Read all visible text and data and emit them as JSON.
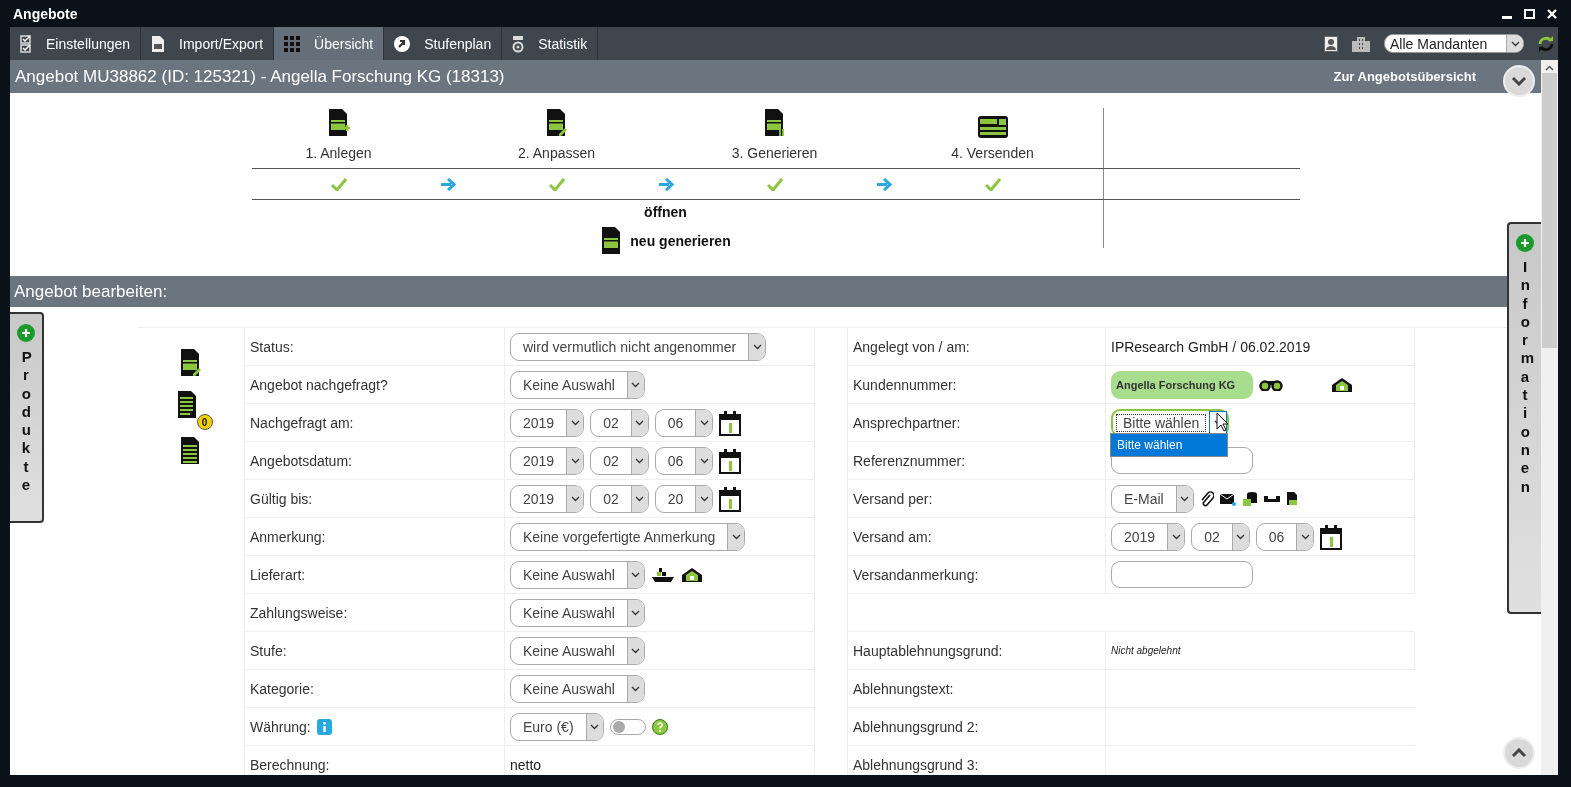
{
  "window": {
    "title": "Angebote"
  },
  "tabs": [
    {
      "label": "Einstellungen",
      "selected": false
    },
    {
      "label": "Import/Export",
      "selected": false
    },
    {
      "label": "Übersicht",
      "selected": true
    },
    {
      "label": "Stufenplan",
      "selected": false
    },
    {
      "label": "Statistik",
      "selected": false
    }
  ],
  "client_select": {
    "value": "Alle Mandanten"
  },
  "header": {
    "title": "Angebot MU38862 (ID: 125321) - Angella Forschung KG (18313)",
    "link": "Zur Angebotsübersicht"
  },
  "steps": [
    {
      "label": "1. Anlegen",
      "done": true
    },
    {
      "label": "2. Anpassen",
      "done": true
    },
    {
      "label": "3. Generieren",
      "done": true
    },
    {
      "label": "4. Versenden",
      "done": true
    }
  ],
  "step_actions": [
    {
      "label": "öffnen",
      "kind": "plain"
    },
    {
      "label": "neu generieren",
      "kind": "icon"
    }
  ],
  "section_title": "Angebot bearbeiten:",
  "side_tabs": {
    "left": "Produkte",
    "right": "Informationen"
  },
  "document_badge": "0",
  "form_left": [
    {
      "label": "Status:",
      "kind": "select",
      "value": "wird vermutlich nicht angenommer"
    },
    {
      "label": "Angebot nachgefragt?",
      "kind": "select",
      "value": "Keine Auswahl"
    },
    {
      "label": "Nachgefragt am:",
      "kind": "date",
      "parts": [
        "2019",
        "02",
        "06"
      ]
    },
    {
      "label": "Angebotsdatum:",
      "kind": "date",
      "parts": [
        "2019",
        "02",
        "06"
      ]
    },
    {
      "label": "Gültig bis:",
      "kind": "date",
      "parts": [
        "2019",
        "02",
        "20"
      ]
    },
    {
      "label": "Anmerkung:",
      "kind": "select",
      "value": "Keine vorgefertigte Anmerkung"
    },
    {
      "label": "Lieferart:",
      "kind": "delivery",
      "value": "Keine Auswahl"
    },
    {
      "label": "Zahlungsweise:",
      "kind": "select",
      "value": "Keine Auswahl"
    },
    {
      "label": "Stufe:",
      "kind": "select",
      "value": "Keine Auswahl"
    },
    {
      "label": "Kategorie:",
      "kind": "select",
      "value": "Keine Auswahl"
    },
    {
      "label": "Währung:",
      "kind": "currency",
      "value": "Euro (€)",
      "info": true,
      "toggle_on": false
    },
    {
      "label": "Berechnung:",
      "kind": "text",
      "value": "netto"
    }
  ],
  "form_right": [
    {
      "label": "Angelegt von / am:",
      "kind": "text",
      "value": "IPResearch GmbH / 06.02.2019"
    },
    {
      "label": "Kundennummer:",
      "kind": "customer",
      "value": "Angella Forschung KG"
    },
    {
      "label": "Ansprechpartner:",
      "kind": "select",
      "value": "Bitte wählen",
      "focused": true,
      "open": true,
      "options": [
        {
          "label": "Bitte wählen",
          "selected": true
        }
      ]
    },
    {
      "label": "Referenznummer:",
      "kind": "input"
    },
    {
      "label": "Versand per:",
      "kind": "send",
      "value": "E-Mail"
    },
    {
      "label": "Versand am:",
      "kind": "date",
      "parts": [
        "2019",
        "02",
        "06"
      ]
    },
    {
      "label": "Versandanmerkung:",
      "kind": "input"
    },
    {
      "kind": "empty"
    },
    {
      "label": "Hauptablehnungsgrund:",
      "kind": "note",
      "value": "Nicht abgelehnt"
    },
    {
      "label": "Ablehnungstext:",
      "kind": "label"
    },
    {
      "label": "Ablehnungsgrund 2:",
      "kind": "label"
    },
    {
      "label": "Ablehnungsgrund 3:",
      "kind": "label"
    }
  ]
}
